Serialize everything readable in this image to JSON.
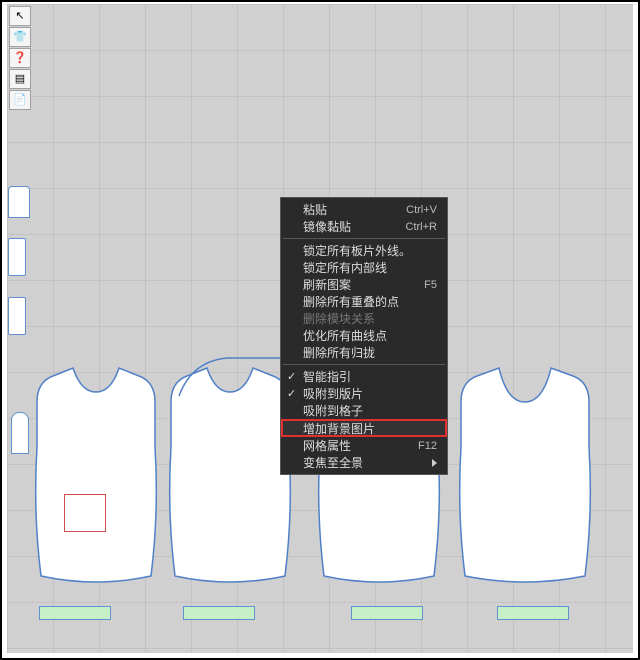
{
  "toolbar": {
    "items": [
      {
        "name": "arrow-tool-icon",
        "glyph": "↖"
      },
      {
        "name": "tshirt-tool-icon",
        "glyph": "👕"
      },
      {
        "name": "help-tool-icon",
        "glyph": "❓"
      },
      {
        "name": "layers-tool-icon",
        "glyph": "▤"
      },
      {
        "name": "note-tool-icon",
        "glyph": "📄"
      }
    ]
  },
  "context_menu": {
    "groups": [
      [
        {
          "label": "粘贴",
          "shortcut": "Ctrl+V"
        },
        {
          "label": "镜像黏贴",
          "shortcut": "Ctrl+R"
        }
      ],
      [
        {
          "label": "锁定所有板片外线。"
        },
        {
          "label": "锁定所有内部线"
        },
        {
          "label": "刷新图案",
          "shortcut": "F5"
        },
        {
          "label": "删除所有重叠的点"
        },
        {
          "label": "删除模块关系",
          "disabled": true
        },
        {
          "label": "优化所有曲线点"
        },
        {
          "label": "删除所有归拢"
        }
      ],
      [
        {
          "label": "智能指引",
          "checked": true
        },
        {
          "label": "吸附到版片",
          "checked": true
        },
        {
          "label": "吸附到格子"
        },
        {
          "label": "增加背景图片",
          "highlighted": true
        },
        {
          "label": "网格属性",
          "shortcut": "F12"
        },
        {
          "label": "变焦至全景",
          "submenu": true
        }
      ]
    ]
  },
  "pieces": {
    "p1": "",
    "p2": "",
    "p3": "",
    "p4": ""
  }
}
